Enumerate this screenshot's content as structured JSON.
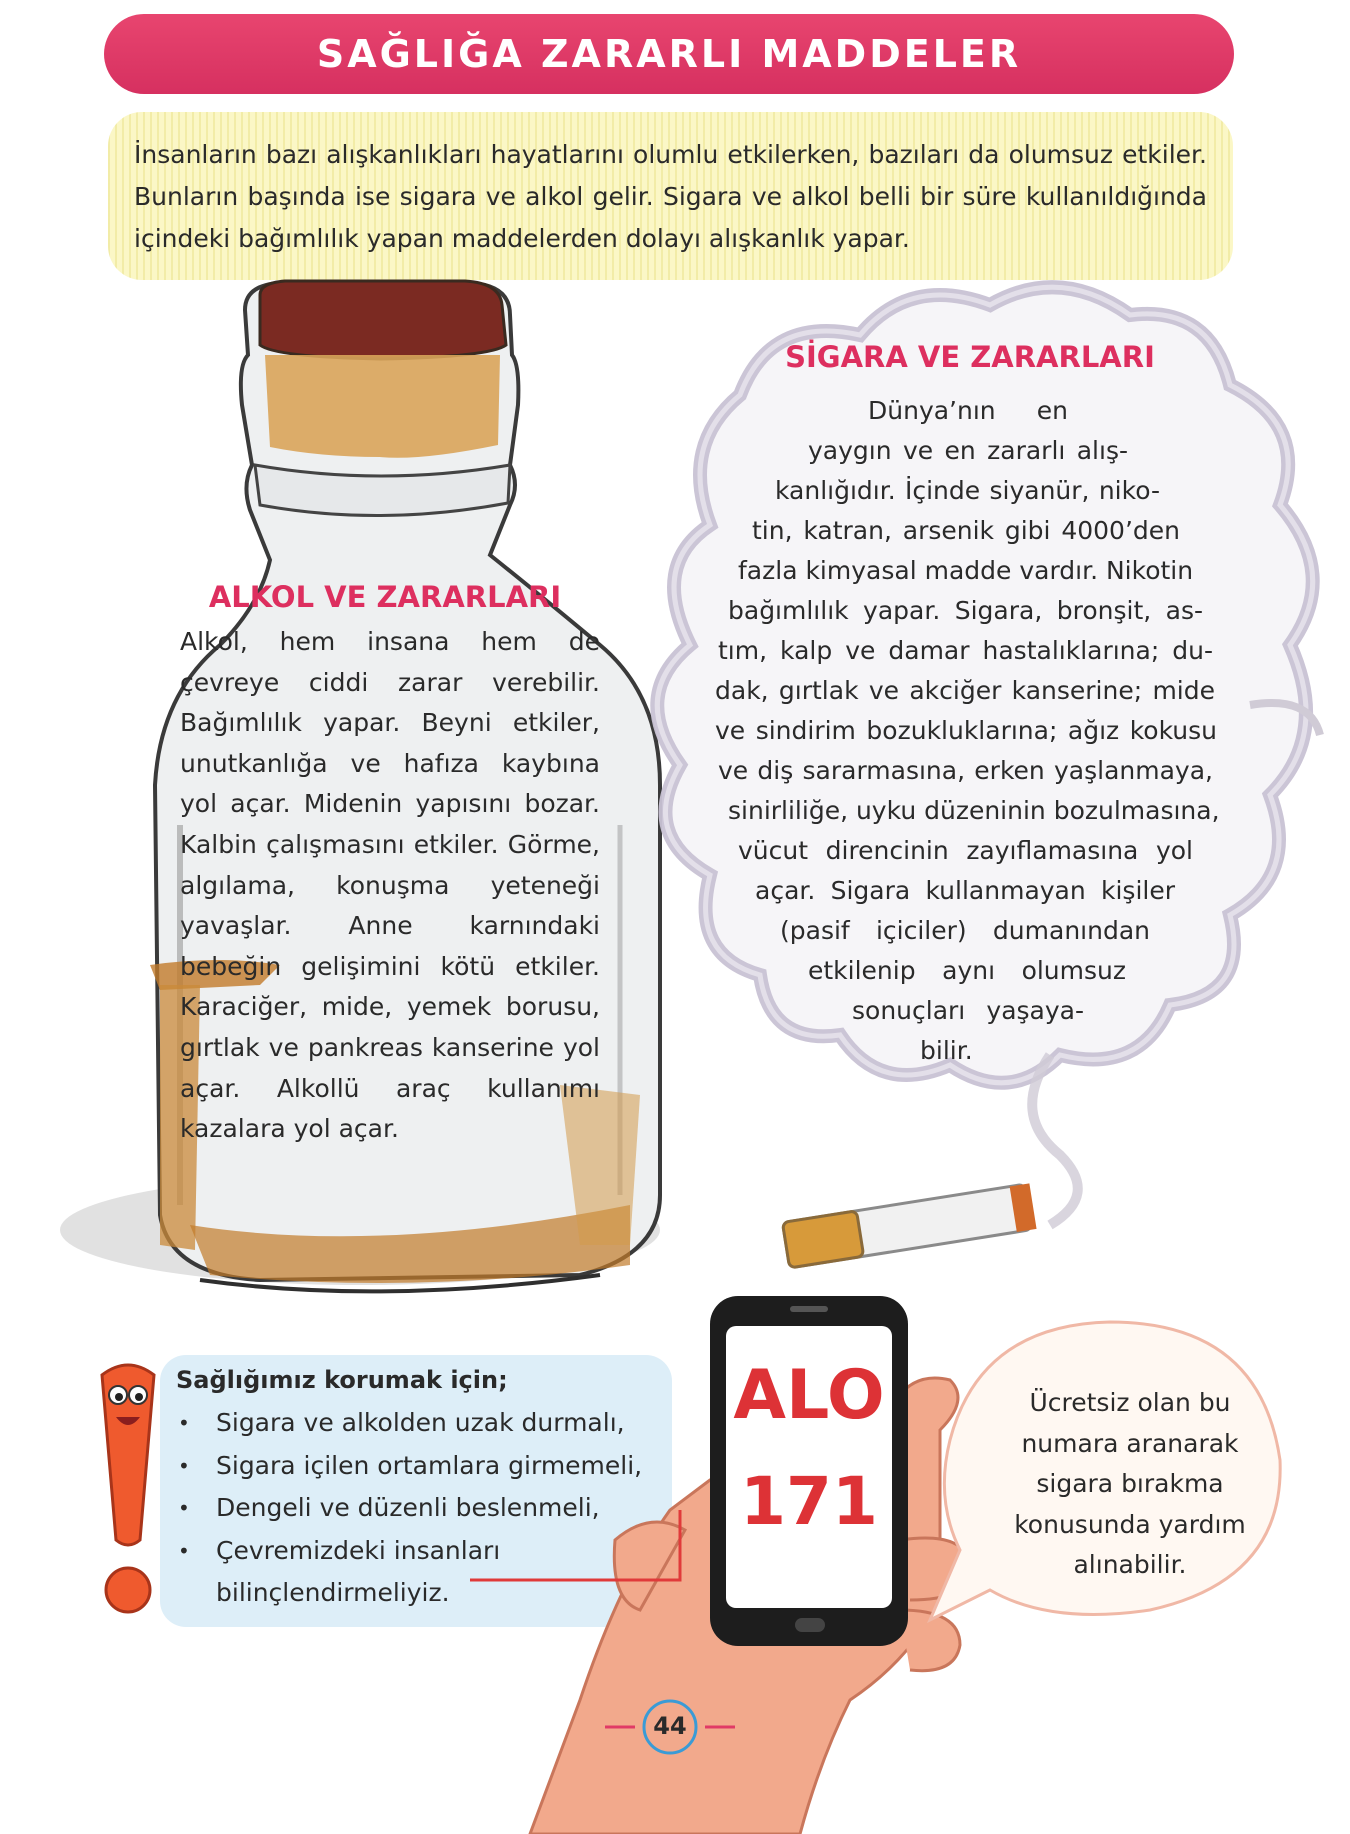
{
  "title": "SAĞLIĞA ZARARLI MADDELER",
  "intro": "İnsanların bazı alışkanlıkları hayatlarını olumlu etkilerken, bazıları da olumsuz etkiler. Bunların başında ise sigara ve alkol gelir. Sigara ve alkol belli bir süre kullanıldığında içindeki bağımlılık yapan maddelerden dolayı alışkanlık yapar.",
  "alkol": {
    "title": "ALKOL VE ZARARLARI",
    "text": "Alkol, hem insana hem de çevreye ciddi zarar verebilir. Bağımlılık yapar. Beyni etkiler, unutkanlığa ve hafıza kaybına yol açar. Midenin yapısını bozar. Kalbin çalışmasını etkiler. Görme, algılama, konuşma yeteneği yavaşlar. Anne karnındaki bebeğin gelişimini kötü etkiler. Karaciğer, mide, yemek borusu, gırtlak ve pankreas kanserine yol açar. Alkollü araç kullanımı kazalara yol açar."
  },
  "sigara": {
    "title": "SİGARA VE ZARARLARI",
    "lines": [
      "Dünya’nın en",
      "yaygın ve en zararlı alış-",
      "kanlığıdır. İçinde siyanür, niko-",
      "tin, katran, arsenik gibi 4000’den",
      "fazla kimyasal madde vardır. Nikotin",
      "bağımlılık yapar. Sigara, bronşit, as-",
      "tım, kalp ve damar hastalıklarına; du-",
      "dak, gırtlak ve akciğer kanserine; mide",
      "ve sindirim bozukluklarına; ağız kokusu",
      "ve diş sararmasına, erken yaşlanmaya,",
      "sinirliliğe, uyku düzeninin bozulmasına,",
      "vücut direncinin zayıflamasına yol",
      "açar. Sigara kullanmayan kişiler",
      "(pasif içiciler) dumanından",
      "etkilenip aynı olumsuz",
      "sonuçları yaşaya-",
      "bilir."
    ]
  },
  "health": {
    "heading": "Sağlığımız korumak için;",
    "items": [
      "Sigara ve alkolden uzak durmalı,",
      "Sigara içilen ortamlara girmemeli,",
      "Dengeli ve düzenli beslenmeli,",
      "Çevremizdeki insanları bilinçlendirmeliyiz."
    ]
  },
  "phone": {
    "alo": "ALO",
    "number": "171"
  },
  "bubble": "Ücretsiz olan bu numara aranarak sigara bırakma konusunda yardım alınabilir.",
  "page_number": "44",
  "colors": {
    "banner": "#e23a66",
    "section_title": "#dd2f5f",
    "alo": "#dd3236",
    "intro_bg": "#fbf7c6",
    "health_bg": "#ddeef8"
  }
}
